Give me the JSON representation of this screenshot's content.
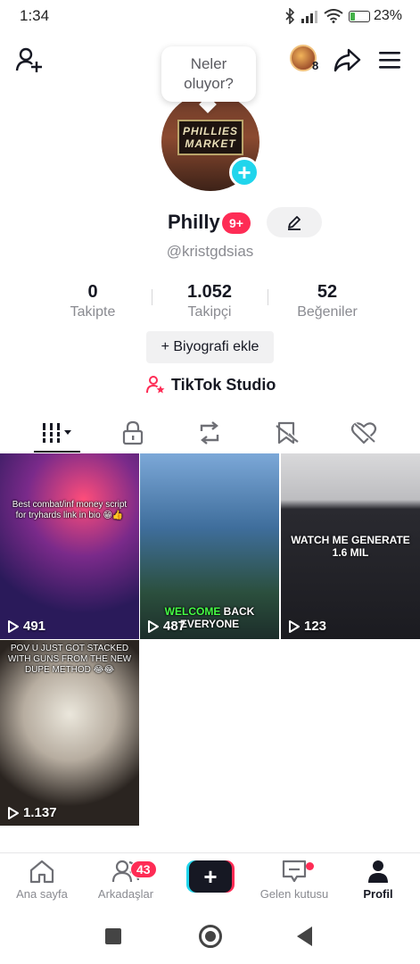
{
  "status_bar": {
    "time": "1:34",
    "battery_percent": 23,
    "battery_label": "23%"
  },
  "header": {
    "story_count": "8"
  },
  "bubble": {
    "text": "Neler oluyor?"
  },
  "profile": {
    "name": "Philly",
    "badge": "9+",
    "handle": "@kristgdsias",
    "avatar_sign_line1": "PHILLIES",
    "avatar_sign_line2": "MARKET"
  },
  "stats": [
    {
      "value": "0",
      "label": "Takipte"
    },
    {
      "value": "1.052",
      "label": "Takipçi"
    },
    {
      "value": "52",
      "label": "Beğeniler"
    }
  ],
  "bio_button": "+ Biyografi ekle",
  "studio_label": "TikTok Studio",
  "tabs": [
    {
      "icon": "grid-icon"
    },
    {
      "icon": "lock-icon"
    },
    {
      "icon": "repost-icon"
    },
    {
      "icon": "bookmark-icon"
    },
    {
      "icon": "liked-heart-icon"
    }
  ],
  "videos": [
    {
      "views": "491",
      "caption": "Best combat/inf money script for tryhards link in bio 😁👍"
    },
    {
      "views": "487",
      "caption_green": "WELCOME",
      "caption_white": "BACK",
      "caption_line2": "EVERYONE"
    },
    {
      "views": "123",
      "caption": "WATCH ME GENERATE 1.6 MIL"
    },
    {
      "views": "1.137",
      "caption": "POV U JUST GOT STACKED WITH GUNS FROM THE NEW DUPE METHOD 😂😂"
    }
  ],
  "bottom_nav": {
    "home": "Ana sayfa",
    "friends": "Arkadaşlar",
    "friends_badge": "43",
    "inbox": "Gelen kutusu",
    "profile": "Profil"
  },
  "colors": {
    "accent": "#fe2c55",
    "cyan": "#20d5ec",
    "text": "#161823",
    "muted": "#8a8b91"
  }
}
